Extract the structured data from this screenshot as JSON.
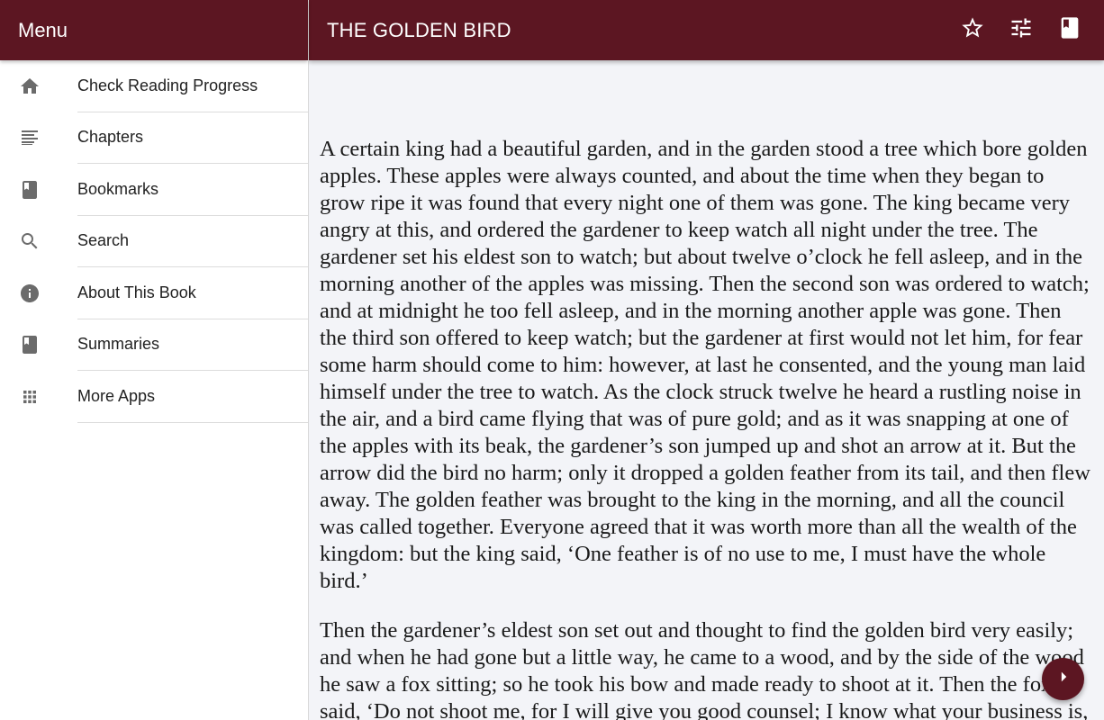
{
  "drawer": {
    "title": "Menu",
    "items": [
      {
        "label": "Check Reading Progress",
        "icon": "home-icon"
      },
      {
        "label": "Chapters",
        "icon": "list-icon"
      },
      {
        "label": "Bookmarks",
        "icon": "book-icon"
      },
      {
        "label": "Search",
        "icon": "search-icon"
      },
      {
        "label": "About This Book",
        "icon": "info-icon"
      },
      {
        "label": "Summaries",
        "icon": "book-icon"
      },
      {
        "label": "More Apps",
        "icon": "apps-grid-icon"
      }
    ]
  },
  "header": {
    "title": "THE GOLDEN BIRD",
    "actions": [
      "star-icon",
      "tune-icon",
      "book-icon"
    ]
  },
  "content": {
    "paragraphs": [
      "A certain king had a beautiful garden, and in the garden stood a tree which bore golden apples. These apples were always counted, and about the time when they began to grow ripe it was found that every night one of them was gone. The king became very angry at this, and ordered the gardener to keep watch all night under the tree. The gardener set his eldest son to watch; but about twelve o’clock he fell asleep, and in the morning another of the apples was missing. Then the second son was ordered to watch; and at midnight he too fell asleep, and in the morning another apple was gone. Then the third son offered to keep watch; but the gardener at first would not let him, for fear some harm should come to him: however, at last he consented, and the young man laid himself under the tree to watch. As the clock struck twelve he heard a rustling noise in the air, and a bird came flying that was of pure gold; and as it was snapping at one of the apples with its beak, the gardener’s son jumped up and shot an arrow at it. But the arrow did the bird no harm; only it dropped a golden feather from its tail, and then flew away. The golden feather was brought to the king in the morning, and all the council was called together. Everyone agreed that it was worth more than all the wealth of the kingdom: but the king said, ‘One feather is of no use to me, I must have the whole bird.’",
      "Then the gardener’s eldest son set out and thought to find the golden bird very easily; and when he had gone but a little way, he came to a wood, and by the side of the wood he saw a fox sitting; so he took his bow and made ready to shoot at it. Then the fox said, ‘Do not shoot me, for I will give you good counsel; I know what your business is, and that you want to find the golden bird."
    ]
  },
  "fab": {
    "icon": "chevron-right-icon"
  },
  "colors": {
    "primary": "#5c1622",
    "background": "#f3f4f8",
    "drawer_bg": "#ffffff"
  }
}
